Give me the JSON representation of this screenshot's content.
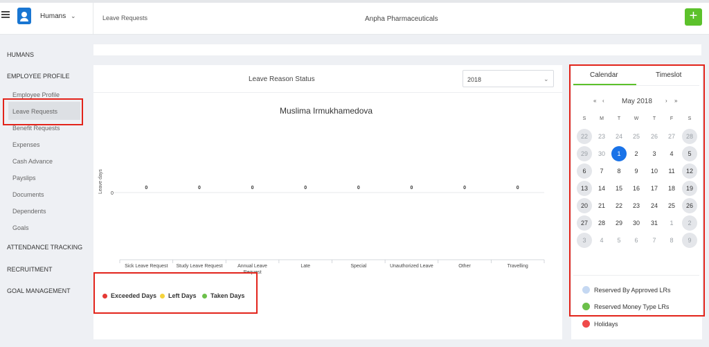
{
  "header": {
    "app_name": "Humans",
    "breadcrumb": "Leave Requests",
    "company": "Anpha Pharmaceuticals",
    "add_label": "+"
  },
  "sidebar": {
    "sections": [
      {
        "label": "HUMANS"
      },
      {
        "label": "EMPLOYEE PROFILE"
      },
      {
        "label": "ATTENDANCE TRACKING"
      },
      {
        "label": "RECRUITMENT"
      },
      {
        "label": "GOAL MANAGEMENT"
      }
    ],
    "items": [
      {
        "label": "Employee Profile"
      },
      {
        "label": "Leave Requests"
      },
      {
        "label": "Benefit Requests"
      },
      {
        "label": "Expenses"
      },
      {
        "label": "Cash Advance"
      },
      {
        "label": "Payslips"
      },
      {
        "label": "Documents"
      },
      {
        "label": "Dependents"
      },
      {
        "label": "Goals"
      }
    ]
  },
  "main": {
    "reason_title": "Leave Reason Status",
    "year": "2018",
    "employee_name": "Muslima Irmukhamedova",
    "legend": [
      {
        "label": "Exceeded Days",
        "color": "#e53935"
      },
      {
        "label": "Left Days",
        "color": "#f5d33b"
      },
      {
        "label": "Taken Days",
        "color": "#6cc04a"
      }
    ]
  },
  "chart_data": {
    "type": "bar",
    "categories": [
      "Sick Leave Request",
      "Study Leave Request",
      "Annual Leave Request",
      "Late",
      "Special",
      "Unauthorized Leave",
      "Other",
      "Travelling"
    ],
    "values": [
      0,
      0,
      0,
      0,
      0,
      0,
      0,
      0
    ],
    "ylabel": "Leave days",
    "yticks": [
      "0"
    ]
  },
  "calendar": {
    "tabs": [
      "Calendar",
      "Timeslot"
    ],
    "month": "May 2018",
    "nav": {
      "first": "«",
      "prev": "‹",
      "next": "›",
      "last": "»"
    },
    "weekdays": [
      "S",
      "M",
      "T",
      "W",
      "T",
      "F",
      "S"
    ],
    "weeks": [
      [
        "22",
        "23",
        "24",
        "25",
        "26",
        "27",
        "28"
      ],
      [
        "29",
        "30",
        "1",
        "2",
        "3",
        "4",
        "5"
      ],
      [
        "6",
        "7",
        "8",
        "9",
        "10",
        "11",
        "12"
      ],
      [
        "13",
        "14",
        "15",
        "16",
        "17",
        "18",
        "19"
      ],
      [
        "20",
        "21",
        "22",
        "23",
        "24",
        "25",
        "26"
      ],
      [
        "27",
        "28",
        "29",
        "30",
        "31",
        "1",
        "2"
      ],
      [
        "3",
        "4",
        "5",
        "6",
        "7",
        "8",
        "9"
      ]
    ],
    "today": "1",
    "legend": [
      {
        "label": "Reserved By Approved LRs",
        "color": "#c5d8f2"
      },
      {
        "label": "Reserved Money Type LRs",
        "color": "#6cc04a"
      },
      {
        "label": "Holidays",
        "color": "#ef4a4a"
      }
    ]
  }
}
